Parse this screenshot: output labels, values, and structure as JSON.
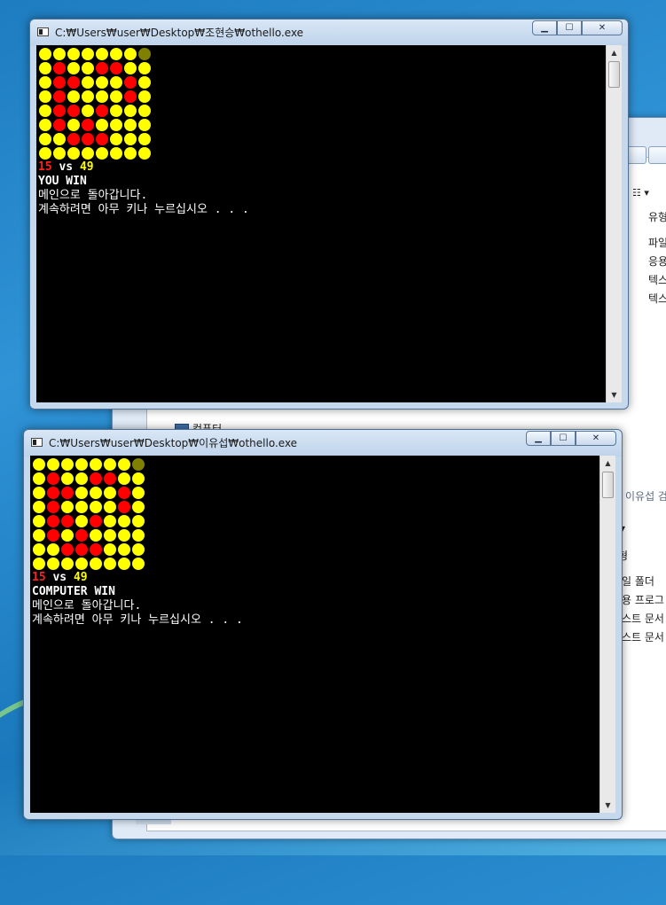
{
  "explorer": {
    "tree_label": "컴퓨터",
    "column_header": "유형",
    "rows": [
      "파일",
      "응용",
      "텍스",
      "텍스"
    ],
    "rows_lower": [
      "형",
      "일 폴더",
      "용 프로그",
      "스트 문서",
      "스트 문서"
    ],
    "search_hint": "이유섭 검"
  },
  "windows": [
    {
      "title": "C:₩Users₩user₩Desktop₩조현승₩othello.exe",
      "board": [
        "yyyyyyyo",
        "yryyrryy",
        "yrryyyry",
        "yryyyyry",
        "yrryryyy",
        "yryryyyy",
        "yyrrryyy",
        "yyyyyyyy"
      ],
      "score_red": "15",
      "score_vs": "vs",
      "score_yellow": "49",
      "result": "YOU WIN",
      "line1": "메인으로 돌아갑니다.",
      "line2": "계속하려면 아무 키나 누르십시오 . . ."
    },
    {
      "title": "C:₩Users₩user₩Desktop₩이유섭₩othello.exe",
      "board": [
        "yyyyyyyo",
        "yryyrryy",
        "yrryyyry",
        "yryyyyry",
        "yrryryyy",
        "yryryyyy",
        "yyrrryyy",
        "yyyyyyyy"
      ],
      "score_red": "15",
      "score_vs": "vs",
      "score_yellow": "49",
      "result": "COMPUTER WIN",
      "line1": "메인으로 돌아갑니다.",
      "line2": "계속하려면 아무 키나 누르십시오 . . ."
    }
  ],
  "colors": {
    "red_disc": "#ff0000",
    "yellow_disc": "#ffff00",
    "cursor_disc": "#808000",
    "console_bg": "#000000"
  }
}
